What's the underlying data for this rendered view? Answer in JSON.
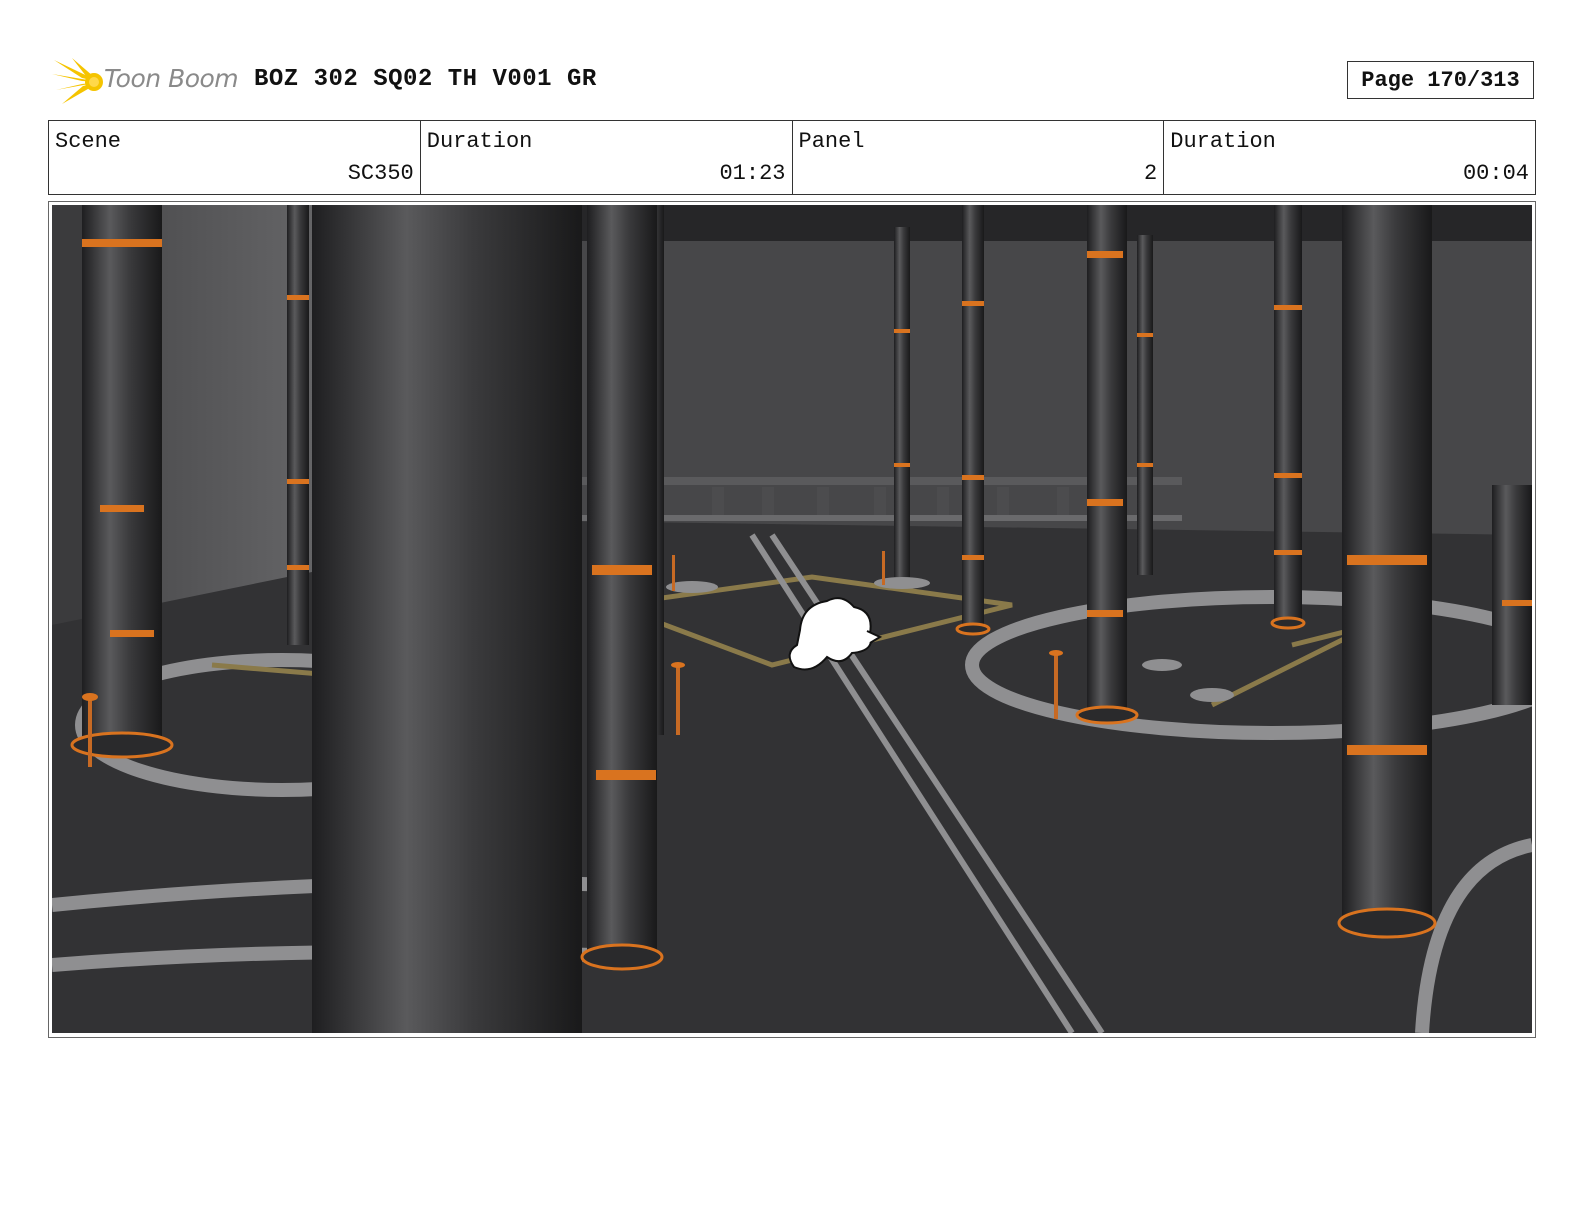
{
  "header": {
    "logo_text": "Toon Boom",
    "title": "BOZ 302 SQ02 TH V001 GR",
    "page": "Page 170/313"
  },
  "info": {
    "scene_label": "Scene",
    "scene_value": "SC350",
    "scene_duration_label": "Duration",
    "scene_duration_value": "01:23",
    "panel_label": "Panel",
    "panel_value": "2",
    "panel_duration_label": "Duration",
    "panel_duration_value": "00:04"
  },
  "colors": {
    "logo_yellow": "#f5c400",
    "pillar_band": "#d9731f",
    "floor_inlay": "#8f8f91",
    "floor_gold": "#8a7a4a"
  }
}
